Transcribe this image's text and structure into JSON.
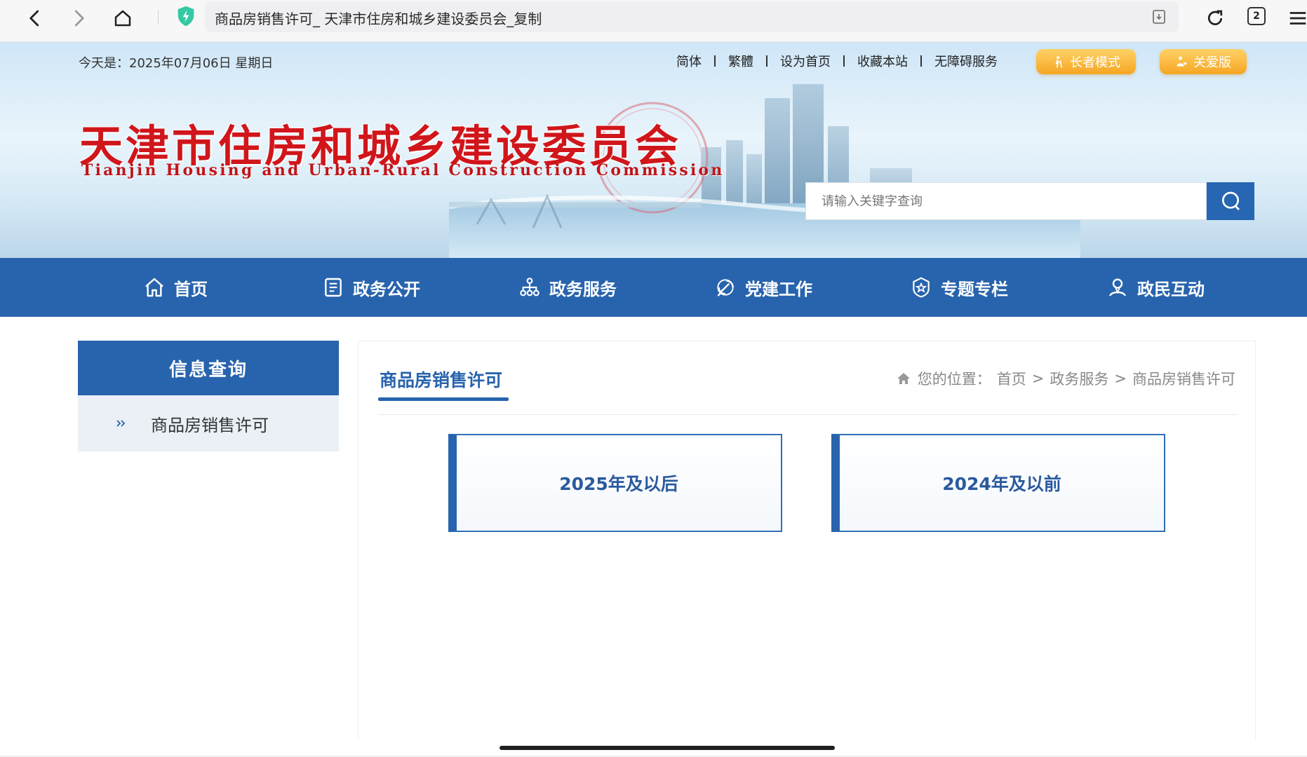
{
  "browser": {
    "page_title": "商品房销售许可_ 天津市住房和城乡建设委员会_复制",
    "tab_count": "2"
  },
  "header": {
    "date": "今天是：2025年07月06日 星期日",
    "links": [
      {
        "label": "简体"
      },
      {
        "label": "繁體"
      },
      {
        "label": "设为首页"
      },
      {
        "label": "收藏本站"
      },
      {
        "label": "无障碍服务"
      }
    ],
    "elder_mode": "长者模式",
    "care_version": "关爱版",
    "site_title_cn": "天津市住房和城乡建设委员会",
    "site_title_en": "Tianjin Housing and Urban-Rural Construction Commission",
    "search_placeholder": "请输入关键字查询"
  },
  "nav": {
    "items": [
      {
        "label": "首页",
        "icon": "home-icon"
      },
      {
        "label": "政务公开",
        "icon": "document-icon"
      },
      {
        "label": "政务服务",
        "icon": "org-chart-icon"
      },
      {
        "label": "党建工作",
        "icon": "party-icon"
      },
      {
        "label": "专题专栏",
        "icon": "star-badge-icon"
      },
      {
        "label": "政民互动",
        "icon": "user-icon"
      }
    ]
  },
  "sidebar": {
    "heading": "信息查询",
    "items": [
      {
        "label": "商品房销售许可"
      }
    ]
  },
  "content": {
    "title": "商品房销售许可",
    "breadcrumb_prefix": "您的位置：",
    "breadcrumb": [
      "首页",
      "政务服务",
      "商品房销售许可"
    ],
    "cards": [
      {
        "label": "2025年及以后"
      },
      {
        "label": "2024年及以前"
      }
    ]
  },
  "colors": {
    "primary_blue": "#2864ad",
    "title_red": "#d0161b",
    "mode_orange": "#f6a623"
  }
}
